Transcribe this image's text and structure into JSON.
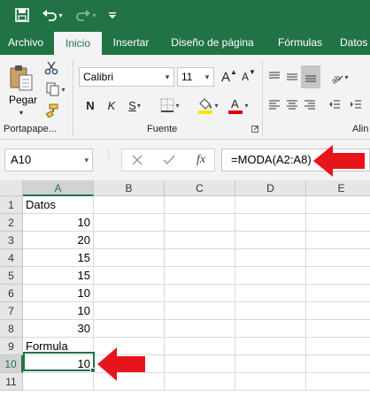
{
  "quick_access": {
    "save_icon": "save-icon",
    "undo_icon": "undo-icon",
    "redo_icon": "redo-icon",
    "customize_icon": "customize-qat-icon"
  },
  "tabs": [
    {
      "label": "Archivo",
      "active": false
    },
    {
      "label": "Inicio",
      "active": true
    },
    {
      "label": "Insertar",
      "active": false
    },
    {
      "label": "Diseño de página",
      "active": false
    },
    {
      "label": "Fórmulas",
      "active": false
    },
    {
      "label": "Datos",
      "active": false
    }
  ],
  "ribbon": {
    "clipboard": {
      "paste_label": "Pegar",
      "group_label": "Portapape..."
    },
    "font": {
      "font_name": "Calibri",
      "font_size": "11",
      "bold_label": "N",
      "italic_label": "K",
      "underline_label": "S",
      "group_label": "Fuente"
    },
    "alignment": {
      "group_label": "Alin"
    }
  },
  "formula_bar": {
    "name_box": "A10",
    "fx_label": "fx",
    "formula": "=MODA(A2:A8)"
  },
  "grid": {
    "columns": [
      "A",
      "B",
      "C",
      "D",
      "E"
    ],
    "selected_column": "A",
    "rows": [
      {
        "row": "1",
        "A": "Datos",
        "type": "text"
      },
      {
        "row": "2",
        "A": "10",
        "type": "num"
      },
      {
        "row": "3",
        "A": "20",
        "type": "num"
      },
      {
        "row": "4",
        "A": "15",
        "type": "num"
      },
      {
        "row": "5",
        "A": "15",
        "type": "num"
      },
      {
        "row": "6",
        "A": "10",
        "type": "num"
      },
      {
        "row": "7",
        "A": "10",
        "type": "num"
      },
      {
        "row": "8",
        "A": "30",
        "type": "num"
      },
      {
        "row": "9",
        "A": "Formula",
        "type": "text"
      },
      {
        "row": "10",
        "A": "10",
        "type": "num"
      },
      {
        "row": "11",
        "A": "",
        "type": "text"
      }
    ],
    "active_cell": "A10"
  },
  "colors": {
    "excel_green": "#217346",
    "annotation_red": "#e8141c",
    "fill_yellow": "#ffe400",
    "font_red": "#e00000"
  }
}
